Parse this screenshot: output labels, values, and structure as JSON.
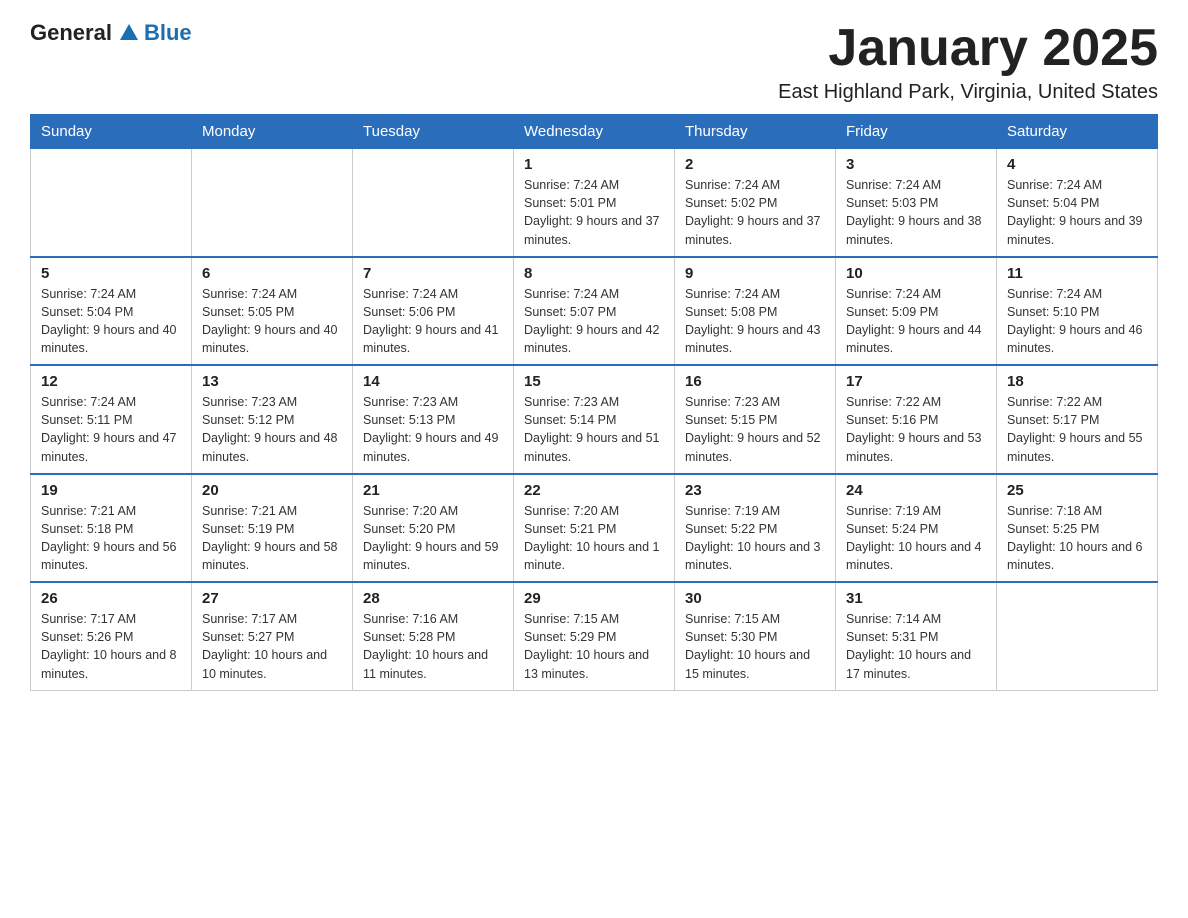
{
  "logo": {
    "general": "General",
    "blue": "Blue"
  },
  "title": "January 2025",
  "location": "East Highland Park, Virginia, United States",
  "days_header": [
    "Sunday",
    "Monday",
    "Tuesday",
    "Wednesday",
    "Thursday",
    "Friday",
    "Saturday"
  ],
  "weeks": [
    [
      {
        "day": "",
        "info": ""
      },
      {
        "day": "",
        "info": ""
      },
      {
        "day": "",
        "info": ""
      },
      {
        "day": "1",
        "info": "Sunrise: 7:24 AM\nSunset: 5:01 PM\nDaylight: 9 hours and 37 minutes."
      },
      {
        "day": "2",
        "info": "Sunrise: 7:24 AM\nSunset: 5:02 PM\nDaylight: 9 hours and 37 minutes."
      },
      {
        "day": "3",
        "info": "Sunrise: 7:24 AM\nSunset: 5:03 PM\nDaylight: 9 hours and 38 minutes."
      },
      {
        "day": "4",
        "info": "Sunrise: 7:24 AM\nSunset: 5:04 PM\nDaylight: 9 hours and 39 minutes."
      }
    ],
    [
      {
        "day": "5",
        "info": "Sunrise: 7:24 AM\nSunset: 5:04 PM\nDaylight: 9 hours and 40 minutes."
      },
      {
        "day": "6",
        "info": "Sunrise: 7:24 AM\nSunset: 5:05 PM\nDaylight: 9 hours and 40 minutes."
      },
      {
        "day": "7",
        "info": "Sunrise: 7:24 AM\nSunset: 5:06 PM\nDaylight: 9 hours and 41 minutes."
      },
      {
        "day": "8",
        "info": "Sunrise: 7:24 AM\nSunset: 5:07 PM\nDaylight: 9 hours and 42 minutes."
      },
      {
        "day": "9",
        "info": "Sunrise: 7:24 AM\nSunset: 5:08 PM\nDaylight: 9 hours and 43 minutes."
      },
      {
        "day": "10",
        "info": "Sunrise: 7:24 AM\nSunset: 5:09 PM\nDaylight: 9 hours and 44 minutes."
      },
      {
        "day": "11",
        "info": "Sunrise: 7:24 AM\nSunset: 5:10 PM\nDaylight: 9 hours and 46 minutes."
      }
    ],
    [
      {
        "day": "12",
        "info": "Sunrise: 7:24 AM\nSunset: 5:11 PM\nDaylight: 9 hours and 47 minutes."
      },
      {
        "day": "13",
        "info": "Sunrise: 7:23 AM\nSunset: 5:12 PM\nDaylight: 9 hours and 48 minutes."
      },
      {
        "day": "14",
        "info": "Sunrise: 7:23 AM\nSunset: 5:13 PM\nDaylight: 9 hours and 49 minutes."
      },
      {
        "day": "15",
        "info": "Sunrise: 7:23 AM\nSunset: 5:14 PM\nDaylight: 9 hours and 51 minutes."
      },
      {
        "day": "16",
        "info": "Sunrise: 7:23 AM\nSunset: 5:15 PM\nDaylight: 9 hours and 52 minutes."
      },
      {
        "day": "17",
        "info": "Sunrise: 7:22 AM\nSunset: 5:16 PM\nDaylight: 9 hours and 53 minutes."
      },
      {
        "day": "18",
        "info": "Sunrise: 7:22 AM\nSunset: 5:17 PM\nDaylight: 9 hours and 55 minutes."
      }
    ],
    [
      {
        "day": "19",
        "info": "Sunrise: 7:21 AM\nSunset: 5:18 PM\nDaylight: 9 hours and 56 minutes."
      },
      {
        "day": "20",
        "info": "Sunrise: 7:21 AM\nSunset: 5:19 PM\nDaylight: 9 hours and 58 minutes."
      },
      {
        "day": "21",
        "info": "Sunrise: 7:20 AM\nSunset: 5:20 PM\nDaylight: 9 hours and 59 minutes."
      },
      {
        "day": "22",
        "info": "Sunrise: 7:20 AM\nSunset: 5:21 PM\nDaylight: 10 hours and 1 minute."
      },
      {
        "day": "23",
        "info": "Sunrise: 7:19 AM\nSunset: 5:22 PM\nDaylight: 10 hours and 3 minutes."
      },
      {
        "day": "24",
        "info": "Sunrise: 7:19 AM\nSunset: 5:24 PM\nDaylight: 10 hours and 4 minutes."
      },
      {
        "day": "25",
        "info": "Sunrise: 7:18 AM\nSunset: 5:25 PM\nDaylight: 10 hours and 6 minutes."
      }
    ],
    [
      {
        "day": "26",
        "info": "Sunrise: 7:17 AM\nSunset: 5:26 PM\nDaylight: 10 hours and 8 minutes."
      },
      {
        "day": "27",
        "info": "Sunrise: 7:17 AM\nSunset: 5:27 PM\nDaylight: 10 hours and 10 minutes."
      },
      {
        "day": "28",
        "info": "Sunrise: 7:16 AM\nSunset: 5:28 PM\nDaylight: 10 hours and 11 minutes."
      },
      {
        "day": "29",
        "info": "Sunrise: 7:15 AM\nSunset: 5:29 PM\nDaylight: 10 hours and 13 minutes."
      },
      {
        "day": "30",
        "info": "Sunrise: 7:15 AM\nSunset: 5:30 PM\nDaylight: 10 hours and 15 minutes."
      },
      {
        "day": "31",
        "info": "Sunrise: 7:14 AM\nSunset: 5:31 PM\nDaylight: 10 hours and 17 minutes."
      },
      {
        "day": "",
        "info": ""
      }
    ]
  ]
}
